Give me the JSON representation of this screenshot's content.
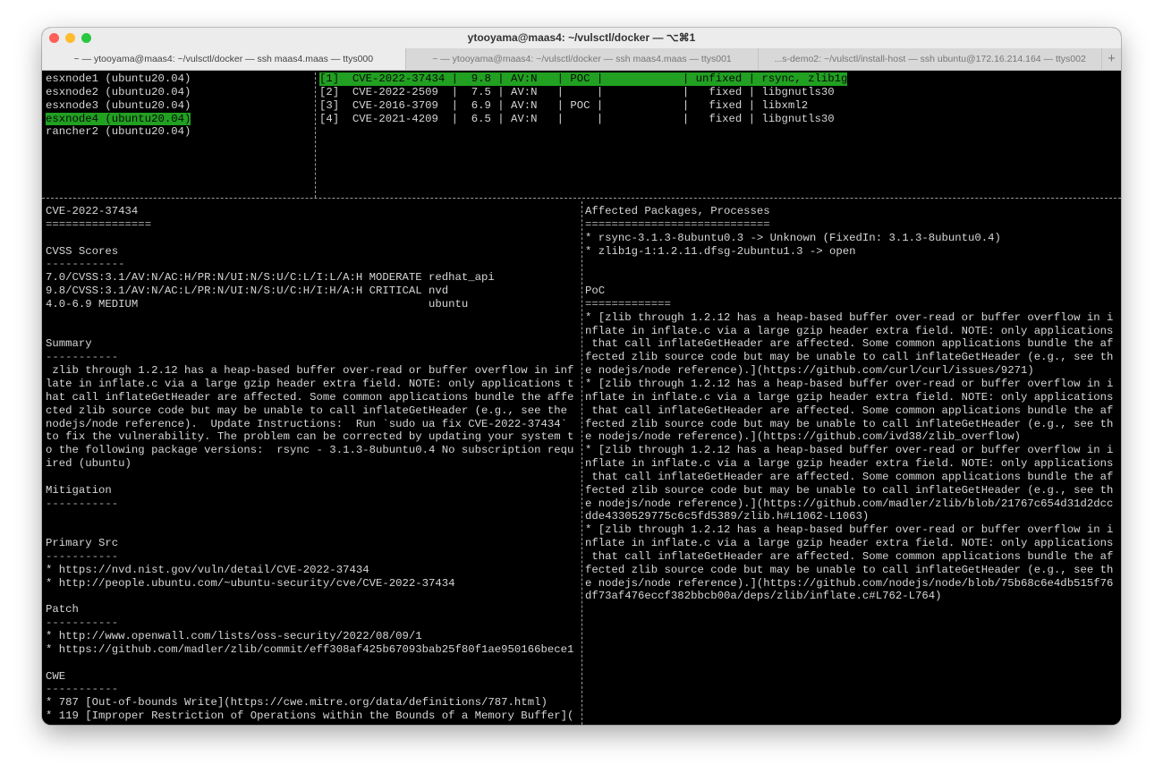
{
  "window": {
    "title": "ytooyama@maas4: ~/vulsctl/docker — ⌥⌘1",
    "colors": {
      "close": "#fe5f57",
      "minimize": "#febc2e",
      "zoom": "#28c840",
      "highlight": "#21a021"
    },
    "tabs": [
      {
        "label": "~ — ytooyama@maas4: ~/vulsctl/docker — ssh maas4.maas — ttys000",
        "active": true
      },
      {
        "label": "~ — ytooyama@maas4: ~/vulsctl/docker — ssh maas4.maas — ttys001",
        "active": false
      },
      {
        "label": "...s-demo2: ~/vulsctl/install-host — ssh ubuntu@172.16.214.164 — ttys002",
        "active": false
      }
    ],
    "new_tab_label": "+"
  },
  "hosts": {
    "selected": 3,
    "items": [
      "esxnode1 (ubuntu20.04)",
      "esxnode2 (ubuntu20.04)",
      "esxnode3 (ubuntu20.04)",
      "esxnode4 (ubuntu20.04)",
      "rancher2 (ubuntu20.04)"
    ]
  },
  "cves": {
    "selected": 0,
    "rows": [
      "[1]  CVE-2022-37434 |  9.8 | AV:N   | POC |            | unfixed | rsync, zlib1g",
      "[2]  CVE-2022-2509  |  7.5 | AV:N   |     |            |   fixed | libgnutls30",
      "[3]  CVE-2016-3709  |  6.9 | AV:N   | POC |            |   fixed | libxml2",
      "[4]  CVE-2021-4209  |  6.5 | AV:N   |     |            |   fixed | libgnutls30"
    ]
  },
  "detail_left": [
    "CVE-2022-37434",
    "================",
    "",
    "CVSS Scores",
    "------------",
    "7.0/CVSS:3.1/AV:N/AC:H/PR:N/UI:N/S:U/C:L/I:L/A:H MODERATE redhat_api",
    "9.8/CVSS:3.1/AV:N/AC:L/PR:N/UI:N/S:U/C:H/I:H/A:H CRITICAL nvd",
    "4.0-6.9 MEDIUM                                            ubuntu",
    "",
    "",
    "Summary",
    "-----------",
    " zlib through 1.2.12 has a heap-based buffer over-read or buffer overflow in inf",
    "late in inflate.c via a large gzip header extra field. NOTE: only applications t",
    "hat call inflateGetHeader are affected. Some common applications bundle the affe",
    "cted zlib source code but may be unable to call inflateGetHeader (e.g., see the ",
    "nodejs/node reference).  Update Instructions:  Run `sudo ua fix CVE-2022-37434` ",
    "to fix the vulnerability. The problem can be corrected by updating your system t",
    "o the following package versions:  rsync - 3.1.3-8ubuntu0.4 No subscription requ",
    "ired (ubuntu)",
    "",
    "Mitigation",
    "-----------",
    "",
    "",
    "Primary Src",
    "-----------",
    "* https://nvd.nist.gov/vuln/detail/CVE-2022-37434",
    "* http://people.ubuntu.com/~ubuntu-security/cve/CVE-2022-37434",
    "",
    "Patch",
    "-----------",
    "* http://www.openwall.com/lists/oss-security/2022/08/09/1",
    "* https://github.com/madler/zlib/commit/eff308af425b67093bab25f80f1ae950166bece1",
    "",
    "CWE",
    "-----------",
    "* 787 [Out-of-bounds Write](https://cwe.mitre.org/data/definitions/787.html)",
    "* 119 [Improper Restriction of Operations within the Bounds of a Memory Buffer]("
  ],
  "detail_right": [
    "Affected Packages, Processes",
    "============================",
    "* rsync-3.1.3-8ubuntu0.3 -> Unknown (FixedIn: 3.1.3-8ubuntu0.4)",
    "* zlib1g-1:1.2.11.dfsg-2ubuntu1.3 -> open",
    "",
    "",
    "PoC",
    "=============",
    "* [zlib through 1.2.12 has a heap-based buffer over-read or buffer overflow in i",
    "nflate in inflate.c via a large gzip header extra field. NOTE: only applications",
    " that call inflateGetHeader are affected. Some common applications bundle the af",
    "fected zlib source code but may be unable to call inflateGetHeader (e.g., see th",
    "e nodejs/node reference).](https://github.com/curl/curl/issues/9271)",
    "* [zlib through 1.2.12 has a heap-based buffer over-read or buffer overflow in i",
    "nflate in inflate.c via a large gzip header extra field. NOTE: only applications",
    " that call inflateGetHeader are affected. Some common applications bundle the af",
    "fected zlib source code but may be unable to call inflateGetHeader (e.g., see th",
    "e nodejs/node reference).](https://github.com/ivd38/zlib_overflow)",
    "* [zlib through 1.2.12 has a heap-based buffer over-read or buffer overflow in i",
    "nflate in inflate.c via a large gzip header extra field. NOTE: only applications",
    " that call inflateGetHeader are affected. Some common applications bundle the af",
    "fected zlib source code but may be unable to call inflateGetHeader (e.g., see th",
    "e nodejs/node reference).](https://github.com/madler/zlib/blob/21767c654d31d2dcc",
    "dde4330529775c6c5fd5389/zlib.h#L1062-L1063)",
    "* [zlib through 1.2.12 has a heap-based buffer over-read or buffer overflow in i",
    "nflate in inflate.c via a large gzip header extra field. NOTE: only applications",
    " that call inflateGetHeader are affected. Some common applications bundle the af",
    "fected zlib source code but may be unable to call inflateGetHeader (e.g., see th",
    "e nodejs/node reference).](https://github.com/nodejs/node/blob/75b68c6e4db515f76",
    "df73af476eccf382bbcb00a/deps/zlib/inflate.c#L762-L764)"
  ]
}
